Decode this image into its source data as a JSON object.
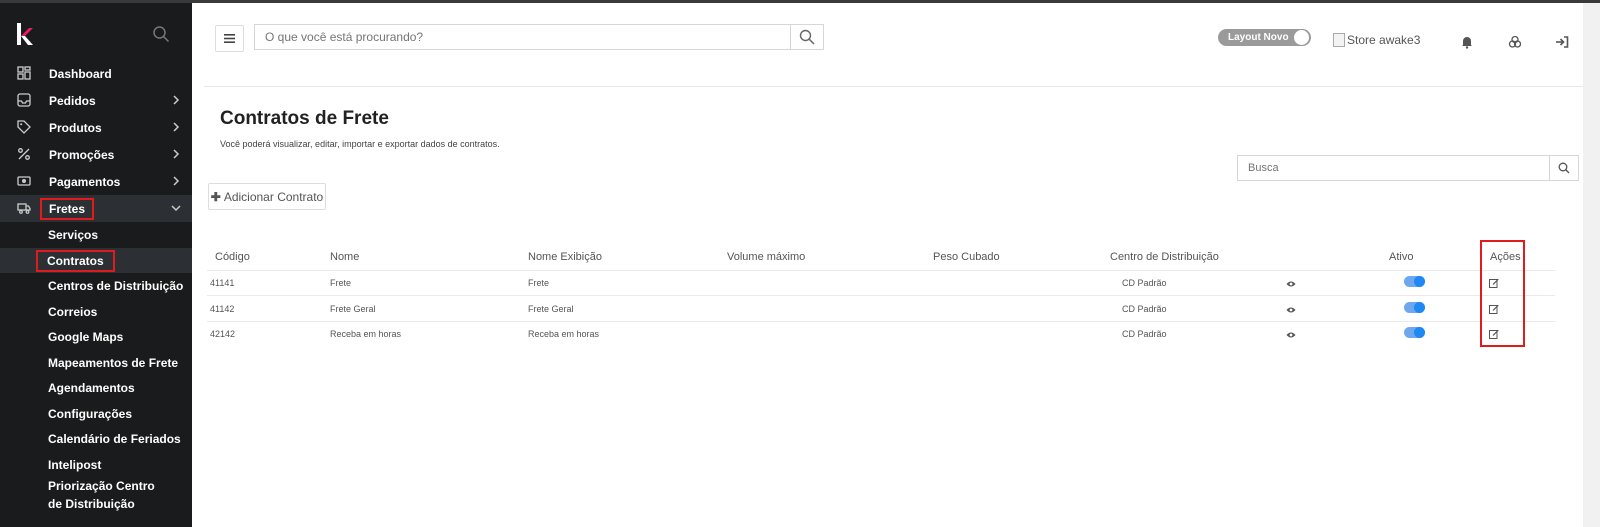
{
  "sidebar": {
    "menu": [
      {
        "label": "Dashboard",
        "icon": "dashboard-icon"
      },
      {
        "label": "Pedidos",
        "icon": "inbox-icon"
      },
      {
        "label": "Produtos",
        "icon": "tag-icon"
      },
      {
        "label": "Promoções",
        "icon": "percent-icon"
      },
      {
        "label": "Pagamentos",
        "icon": "money-icon"
      },
      {
        "label": "Fretes",
        "icon": "truck-icon"
      }
    ],
    "submenu": [
      "Serviços",
      "Contratos",
      "Centros de Distribuição",
      "Correios",
      "Google Maps",
      "Mapeamentos de Frete",
      "Agendamentos",
      "Configurações",
      "Calendário de Feriados",
      "Intelipost",
      "Priorização Centro de Distribuição"
    ]
  },
  "header": {
    "search_placeholder": "O que você está procurando?",
    "toggle_label": "Layout Novo",
    "store_alt": "Store awake3"
  },
  "page": {
    "title": "Contratos de Frete",
    "subtitle": "Você poderá visualizar, editar, importar e exportar dados de contratos.",
    "busca_placeholder": "Busca",
    "add_button": "Adicionar Contrato"
  },
  "table": {
    "headers": [
      "Código",
      "Nome",
      "Nome Exibição",
      "Volume máximo",
      "Peso Cubado",
      "Centro de Distribuição",
      "Ativo",
      "Ações"
    ],
    "rows": [
      {
        "codigo": "41141",
        "nome": "Frete",
        "exibicao": "Frete",
        "cd": "CD Padrão",
        "ativo": true
      },
      {
        "codigo": "41142",
        "nome": "Frete Geral",
        "exibicao": "Frete Geral",
        "cd": "CD Padrão",
        "ativo": true
      },
      {
        "codigo": "42142",
        "nome": "Receba em horas",
        "exibicao": "Receba em horas",
        "cd": "CD Padrão",
        "ativo": true
      }
    ]
  },
  "colors": {
    "sidebar_bg": "#1a1b1c",
    "highlight": "#e01b1b",
    "switch_on": "#1e88f5"
  }
}
